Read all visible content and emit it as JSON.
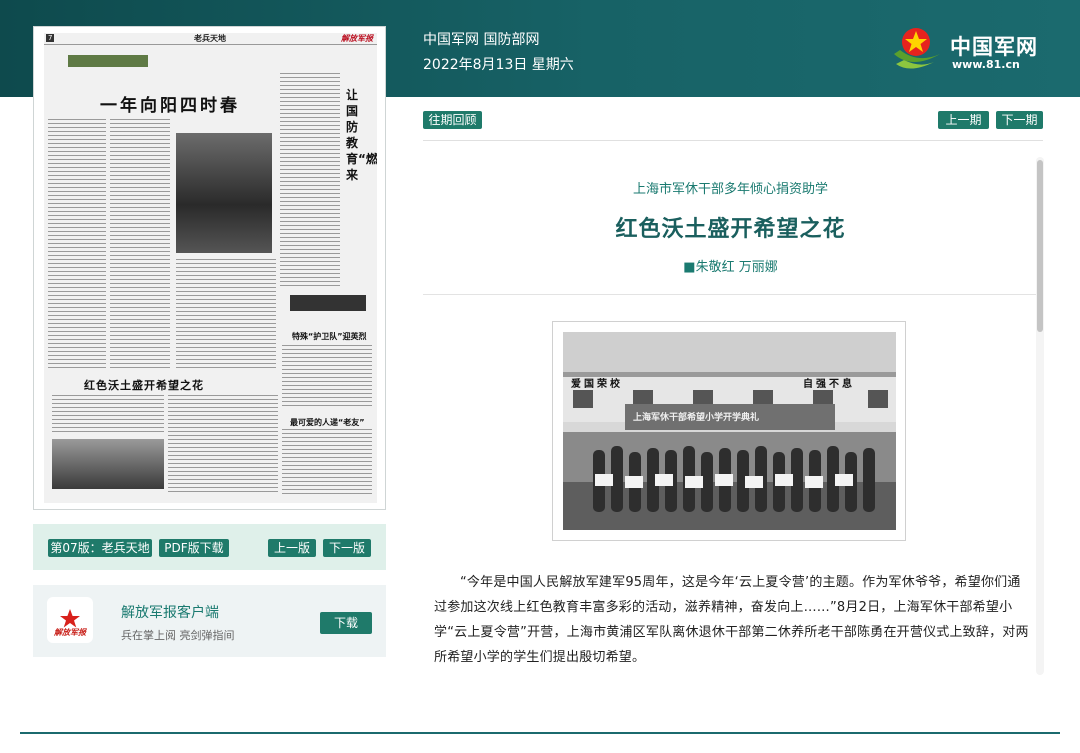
{
  "header": {
    "site_links": "中国军网 国防部网",
    "date": "2022年8月13日 星期六",
    "logo_text": "中国军网",
    "logo_url": "www.81.cn",
    "logo_icon": "army-star-icon"
  },
  "newspaper": {
    "page_label": "7",
    "section_title": "老兵天地",
    "brand": "解放军报",
    "headline_main": "一年向阳四时春",
    "headline_vertical": "让国防教育“燃”起来",
    "headline_second": "红色沃土盛开希望之花",
    "headline_third": "特殊“护卫队”迎英烈",
    "headline_fourth": "最可爱的人递“老友”"
  },
  "edition_nav": {
    "current_edition": "第07版：老兵天地",
    "pdf_download": "PDF版下载",
    "prev_edition": "上一版",
    "next_edition": "下一版"
  },
  "client_app": {
    "title": "解放军报客户端",
    "subtitle": "兵在掌上阅 亮剑弹指间",
    "download": "下载",
    "logo_text": "解放军报"
  },
  "issue_nav": {
    "archive": "往期回顾",
    "prev_issue": "上一期",
    "next_issue": "下一期"
  },
  "article": {
    "subtitle": "上海市军休干部多年倾心捐资助学",
    "title": "红色沃土盛开希望之花",
    "author": "■朱敬红 万丽娜",
    "photo_banner": "上海军休干部希望小学开学典礼",
    "photo_sign_left": "爱国荣校",
    "photo_sign_right": "自强不息",
    "body": "“今年是中国人民解放军建军95周年，这是今年‘云上夏令营’的主题。作为军休爷爷，希望你们通过参加这次线上红色教育丰富多彩的活动，滋养精神，奋发向上……”8月2日，上海军休干部希望小学“云上夏令营”开营，上海市黄浦区军队离休退休干部第二休养所老干部陈勇在开营仪式上致辞，对两所希望小学的学生们提出殷切希望。"
  },
  "colors": {
    "header_bg": "#176266",
    "accent": "#1f7a6a",
    "title": "#1a5f5e"
  }
}
